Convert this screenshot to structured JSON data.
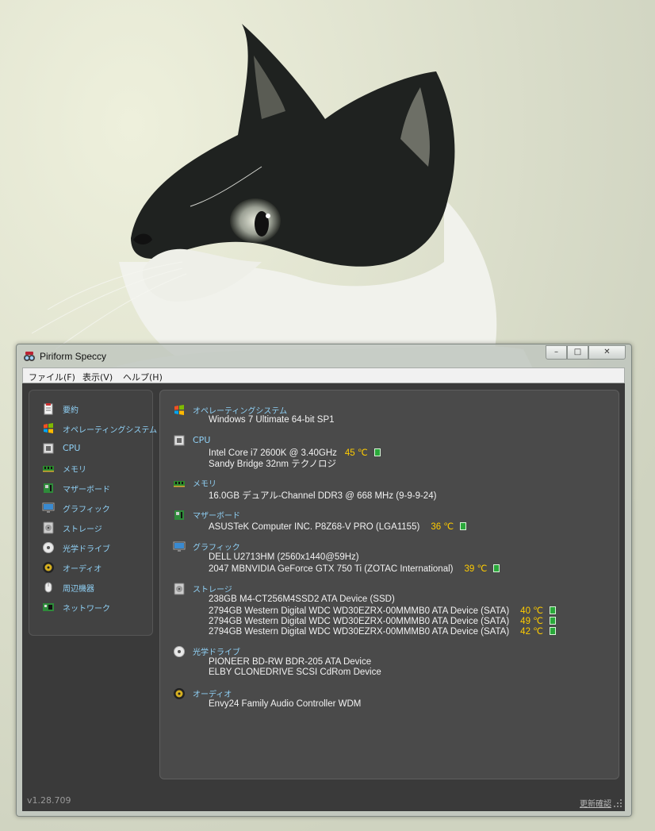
{
  "window": {
    "title": "Piriform Speccy",
    "controls": {
      "minimize": "–",
      "maximize": "□",
      "close": "✕"
    }
  },
  "menu": [
    {
      "label": "ファイル(F)"
    },
    {
      "label": "表示(V)"
    },
    {
      "label": "ヘルプ(H)"
    }
  ],
  "sidebar": {
    "items": [
      {
        "label": "要約",
        "icon": "summary-icon"
      },
      {
        "label": "オペレーティングシステム",
        "icon": "windows-icon"
      },
      {
        "label": "CPU",
        "icon": "cpu-icon"
      },
      {
        "label": "メモリ",
        "icon": "memory-icon"
      },
      {
        "label": "マザーボード",
        "icon": "motherboard-icon"
      },
      {
        "label": "グラフィック",
        "icon": "graphics-icon"
      },
      {
        "label": "ストレージ",
        "icon": "storage-icon"
      },
      {
        "label": "光学ドライブ",
        "icon": "optical-drive-icon"
      },
      {
        "label": "オーディオ",
        "icon": "audio-icon"
      },
      {
        "label": "周辺機器",
        "icon": "peripherals-icon"
      },
      {
        "label": "ネットワーク",
        "icon": "network-icon"
      }
    ]
  },
  "summary": {
    "os": {
      "title": "オペレーティングシステム",
      "lines": [
        "Windows 7 Ultimate 64-bit SP1"
      ]
    },
    "cpu": {
      "title": "CPU",
      "line1": "Intel Core i7 2600K @ 3.40GHz",
      "temp": "45 ℃",
      "line2": "Sandy Bridge 32nm テクノロジ"
    },
    "memory": {
      "title": "メモリ",
      "lines": [
        "16.0GB デュアル-Channel DDR3 @ 668 MHz (9-9-9-24)"
      ]
    },
    "motherboard": {
      "title": "マザーボード",
      "line1": "ASUSTeK Computer INC. P8Z68-V PRO (LGA1155)",
      "temp": "36 ℃"
    },
    "graphics": {
      "title": "グラフィック",
      "line1": "DELL U2713HM (2560x1440@59Hz)",
      "line2": "2047 MBNVIDIA GeForce GTX 750 Ti (ZOTAC International)",
      "temp": "39 ℃"
    },
    "storage": {
      "title": "ストレージ",
      "drives": [
        {
          "name": "238GB M4-CT256M4SSD2 ATA Device (SSD)",
          "temp": ""
        },
        {
          "name": "2794GB Western Digital WDC WD30EZRX-00MMMB0 ATA Device (SATA)",
          "temp": "40 ℃"
        },
        {
          "name": "2794GB Western Digital WDC WD30EZRX-00MMMB0 ATA Device (SATA)",
          "temp": "49 ℃"
        },
        {
          "name": "2794GB Western Digital WDC WD30EZRX-00MMMB0 ATA Device (SATA)",
          "temp": "42 ℃"
        }
      ]
    },
    "optical": {
      "title": "光学ドライブ",
      "lines": [
        "PIONEER BD-RW BDR-205 ATA Device",
        "ELBY CLONEDRIVE SCSI CdRom Device"
      ]
    },
    "audio": {
      "title": "オーディオ",
      "lines": [
        "Envy24 Family Audio Controller WDM"
      ]
    }
  },
  "footer": {
    "version": "v1.28.709",
    "update_link": "更新確認"
  },
  "colors": {
    "accent": "#8fd0f5",
    "temperature": "#ffcc00",
    "temp_ok": "#2aa83a",
    "panel": "#4a4a4a"
  }
}
